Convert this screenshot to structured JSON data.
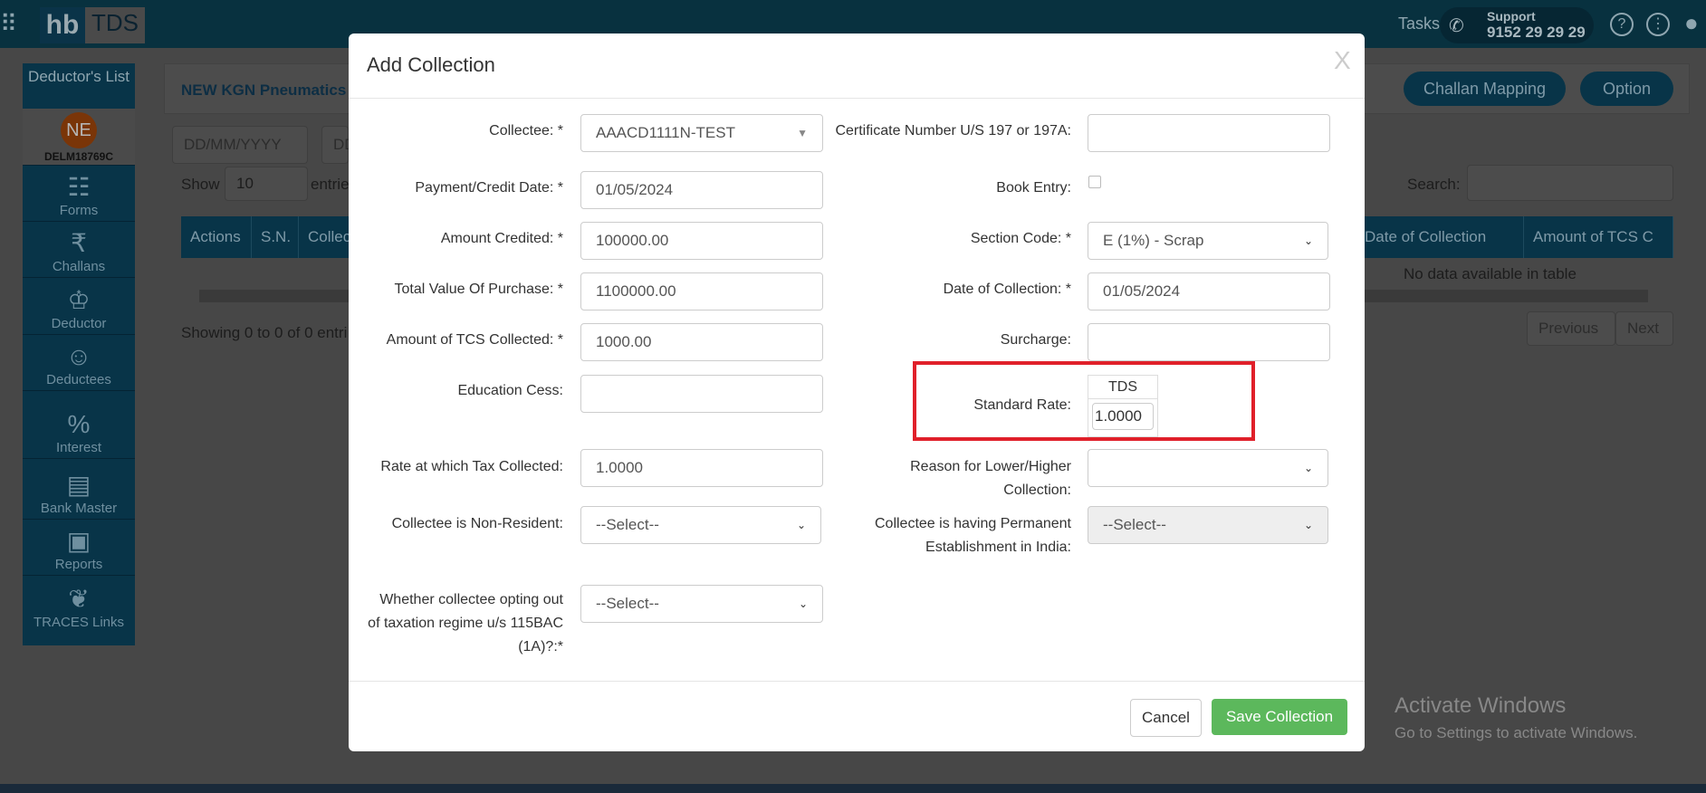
{
  "header": {
    "logo_left": "hb",
    "logo_right": "TDS",
    "tasks": "Tasks",
    "support_label": "Support",
    "support_phone": "9152 29 29 29",
    "icons": [
      "apps-grid-icon",
      "phone-icon",
      "help-icon",
      "more-vertical-icon",
      "user-icon"
    ]
  },
  "sidebar": {
    "title": "Deductor's List",
    "avatar": "NE",
    "code": "DELM18769C",
    "items": [
      {
        "label": "Forms",
        "icon": "forms-icon"
      },
      {
        "label": "Challans",
        "icon": "challan-icon"
      },
      {
        "label": "Deductor",
        "icon": "crown-icon"
      },
      {
        "label": "Deductees",
        "icon": "person-icon"
      },
      {
        "label": "Interest",
        "icon": "money-bag-icon"
      },
      {
        "label": "Bank Master",
        "icon": "bank-icon"
      },
      {
        "label": "Reports",
        "icon": "clipboard-icon"
      },
      {
        "label": "TRACES Links",
        "icon": "traces-icon"
      }
    ]
  },
  "page": {
    "breadcrumb": "NEW KGN Pneumatics >",
    "buttons": [
      "Challan Mapping",
      "Option"
    ],
    "date_placeholder": "DD/MM/YYYY",
    "date_placeholder2": "DD",
    "show": "Show",
    "entries_value": "10",
    "entries": "entrie",
    "search_label": "Search:",
    "columns": [
      "Actions",
      "S.N.",
      "Collec",
      "Date of Collection",
      "Amount of TCS C"
    ],
    "empty": "No data available in table",
    "showing": "Showing 0 to 0 of 0 entri",
    "previous": "Previous",
    "next": "Next"
  },
  "modal": {
    "title": "Add Collection",
    "close": "X",
    "left": [
      {
        "label": "Collectee: *",
        "value": "AAACD1111N-TEST",
        "type": "combo"
      },
      {
        "label": "Payment/Credit Date: *",
        "value": "01/05/2024",
        "type": "text"
      },
      {
        "label": "Amount Credited: *",
        "value": "100000.00",
        "type": "text"
      },
      {
        "label": "Total Value Of Purchase: *",
        "value": "1100000.00",
        "type": "text"
      },
      {
        "label": "Amount of TCS Collected: *",
        "value": "1000.00",
        "type": "text"
      },
      {
        "label": "Education Cess:",
        "value": "",
        "type": "text"
      },
      {
        "label": "Rate at which Tax Collected:",
        "value": "1.0000",
        "type": "text"
      },
      {
        "label": "Collectee is Non-Resident:",
        "value": "--Select--",
        "type": "select"
      },
      {
        "label": "Whether collectee opting out of taxation regime u/s 115BAC (1A)?:*",
        "value": "--Select--",
        "type": "select"
      }
    ],
    "right": [
      {
        "label": "Certificate Number U/S 197 or 197A:",
        "value": "",
        "type": "text"
      },
      {
        "label": "Book Entry:",
        "checked": false,
        "type": "checkbox"
      },
      {
        "label": "Section Code: *",
        "value": "E (1%) - Scrap",
        "type": "select"
      },
      {
        "label": "Date of Collection: *",
        "value": "01/05/2024",
        "type": "text"
      },
      {
        "label": "Surcharge:",
        "value": "",
        "type": "text"
      },
      {
        "label": "Standard Rate:",
        "column": "TDS",
        "value": "1.0000",
        "type": "rate"
      },
      {
        "label": "Reason for Lower/Higher Collection:",
        "value": "",
        "type": "select"
      },
      {
        "label": "Collectee is having Permanent Establishment in India:",
        "value": "--Select--",
        "type": "select",
        "disabled": true
      }
    ],
    "cancel": "Cancel",
    "save": "Save Collection"
  },
  "watermark": {
    "line1": "Activate Windows",
    "line2": "Go to Settings to activate Windows."
  },
  "colors": {
    "brand": "#0e5a7a",
    "save": "#5cb85c",
    "highlight": "#e0202a"
  }
}
